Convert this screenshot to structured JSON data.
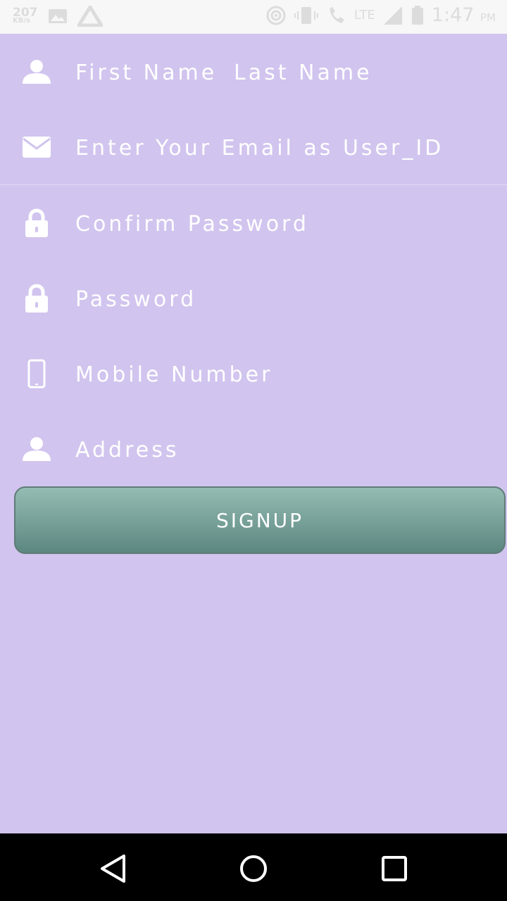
{
  "status_bar": {
    "data_speed": "207",
    "data_unit": "KB/s",
    "network": "LTE",
    "time": "1:47",
    "ampm": "PM"
  },
  "form": {
    "first_name_placeholder": "First Name",
    "last_name_placeholder": "Last Name",
    "email_placeholder": "Enter Your Email as User_ID",
    "confirm_password_placeholder": "Confirm Password",
    "password_placeholder": "Password",
    "mobile_placeholder": "Mobile Number",
    "address_placeholder": "Address"
  },
  "signup_label": "SIGNUP",
  "icons": {
    "name": "person-icon",
    "email": "envelope-icon",
    "confirm_password": "lock-icon",
    "password": "lock-icon",
    "mobile": "phone-icon",
    "address": "person-icon"
  },
  "colors": {
    "background": "#d1c4ee",
    "button_top": "#94bcb3",
    "button_bottom": "#5c8780",
    "text": "#ffffff"
  }
}
